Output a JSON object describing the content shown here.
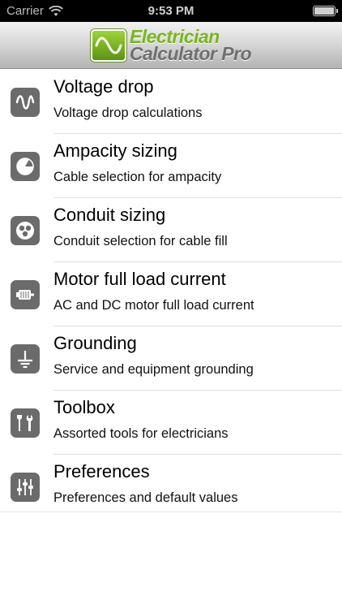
{
  "status_bar": {
    "carrier": "Carrier",
    "time": "9:53 PM"
  },
  "header": {
    "logo_line1": "Electrician",
    "logo_line2": "Calculator Pro"
  },
  "menu": {
    "items": [
      {
        "title": "Voltage drop",
        "subtitle": "Voltage drop calculations",
        "icon": "sine-wave-icon"
      },
      {
        "title": "Ampacity sizing",
        "subtitle": "Cable selection for ampacity",
        "icon": "cable-cross-section-icon"
      },
      {
        "title": "Conduit sizing",
        "subtitle": "Conduit selection for cable fill",
        "icon": "conduit-icon"
      },
      {
        "title": "Motor full load current",
        "subtitle": "AC and DC motor full load current",
        "icon": "motor-icon"
      },
      {
        "title": "Grounding",
        "subtitle": "Service and equipment grounding",
        "icon": "ground-icon"
      },
      {
        "title": "Toolbox",
        "subtitle": "Assorted tools for electricians",
        "icon": "tools-icon"
      },
      {
        "title": "Preferences",
        "subtitle": "Preferences and default values",
        "icon": "sliders-icon"
      }
    ]
  },
  "colors": {
    "icon_background": "#6b6b6b",
    "logo_green": "#7ab51f",
    "logo_gray": "#6f6f6f"
  }
}
